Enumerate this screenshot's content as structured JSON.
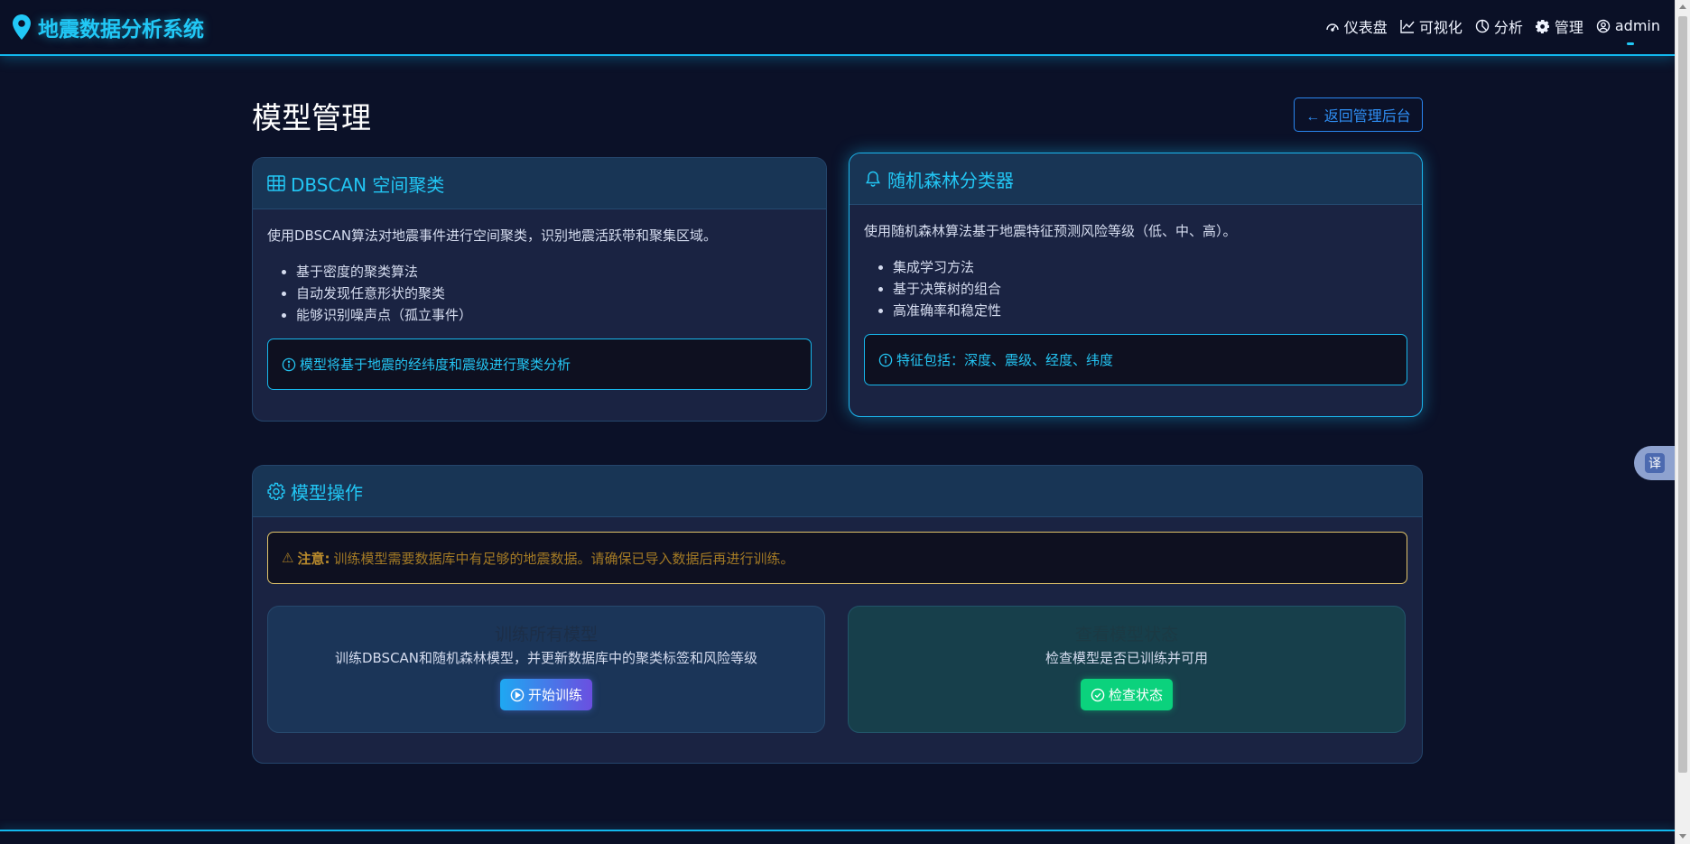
{
  "brand": {
    "title": "地震数据分析系统",
    "icon": "map-pin-icon"
  },
  "nav": [
    {
      "label": "仪表盘",
      "icon": "dashboard-icon"
    },
    {
      "label": "可视化",
      "icon": "line-chart-icon"
    },
    {
      "label": "分析",
      "icon": "pie-chart-icon"
    },
    {
      "label": "管理",
      "icon": "gear-icon"
    },
    {
      "label": "admin",
      "icon": "user-circle-icon"
    }
  ],
  "page": {
    "title": "模型管理",
    "back_label": "← 返回管理后台"
  },
  "dbscan": {
    "title": "DBSCAN 空间聚类",
    "description": "使用DBSCAN算法对地震事件进行空间聚类，识别地震活跃带和聚集区域。",
    "features": [
      "基于密度的聚类算法",
      "自动发现任意形状的聚类",
      "能够识别噪声点（孤立事件）"
    ],
    "info": "模型将基于地震的经纬度和震级进行聚类分析"
  },
  "rf": {
    "title": "随机森林分类器",
    "description": "使用随机森林算法基于地震特征预测风险等级（低、中、高）。",
    "features": [
      "集成学习方法",
      "基于决策树的组合",
      "高准确率和稳定性"
    ],
    "info": "特征包括：深度、震级、经度、纬度"
  },
  "ops": {
    "title": "模型操作",
    "warning_label": "注意:",
    "warning_text": "训练模型需要数据库中有足够的地震数据。请确保已导入数据后再进行训练。",
    "train": {
      "title": "训练所有模型",
      "description": "训练DBSCAN和随机森林模型，并更新数据库中的聚类标签和风险等级",
      "button": "开始训练"
    },
    "check": {
      "title": "查看模型状态",
      "description": "检查模型是否已训练并可用",
      "button": "检查状态"
    }
  },
  "translate": {
    "label": "译"
  },
  "colors": {
    "accent": "#21c8f6",
    "background": "#0b1128",
    "card": "#1a2342",
    "success": "#0bd27d",
    "warning": "#e0c46a"
  }
}
